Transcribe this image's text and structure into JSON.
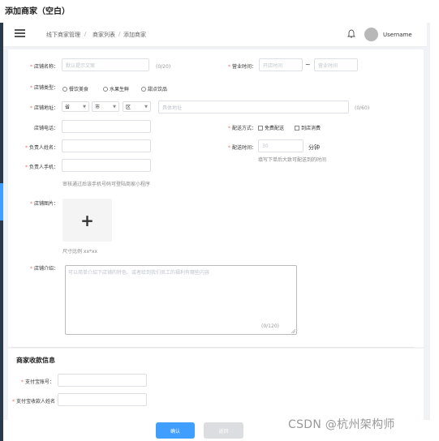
{
  "page_title": "添加商家（空白）",
  "header": {
    "breadcrumb": [
      "线下商家管理",
      "商家列表",
      "添加商家"
    ],
    "breadcrumb_sep": "/",
    "username": "Username"
  },
  "form": {
    "store_name": {
      "label": "店铺名称：",
      "placeholder": "默认提示文案",
      "counter": "(0/20)"
    },
    "business_hours": {
      "label": "营业时间：",
      "start_placeholder": "开店时间",
      "range_sep": "~",
      "end_placeholder": "营业时间"
    },
    "store_type": {
      "label": "店铺类型：",
      "options": [
        "餐饮美食",
        "水果生鲜",
        "甜点饮品"
      ]
    },
    "store_address": {
      "label": "店铺地址：",
      "province": "省",
      "city": "市",
      "district": "区",
      "detail_placeholder": "具体地址",
      "counter": "(0/60)"
    },
    "store_phone": {
      "label": "店铺电话："
    },
    "delivery_method": {
      "label": "配送方式：",
      "options": [
        "免费配送",
        "到店消费"
      ]
    },
    "owner_name": {
      "label": "负责人姓名："
    },
    "delivery_time": {
      "label": "配送时间：",
      "placeholder": "30",
      "unit": "分钟",
      "hint": "填写下单后大致可配送到的时间"
    },
    "owner_phone": {
      "label": "负责人手机：",
      "hint": "审核通过后该手机号码可登陆商家小程序"
    },
    "store_image": {
      "label": "店铺图片：",
      "plus": "+",
      "hint": "尺寸比例 xx*xx"
    },
    "store_intro": {
      "label": "店铺介绍：",
      "placeholder": "可以简单介绍下店铺的特色、或者给到我们员工的福利有哪些内容",
      "counter": "(0/120)"
    }
  },
  "payment_section": {
    "title": "商家收款信息",
    "alipay_account": {
      "label": "支付宝账号："
    },
    "alipay_name": {
      "label": "支付宝收款人姓名"
    }
  },
  "actions": {
    "confirm": "确认",
    "return": "返回"
  },
  "watermark": "CSDN @杭州架构师",
  "colors": {
    "primary": "#409eff",
    "required": "#f56c6c",
    "sidebar": "#2b3a4a"
  }
}
